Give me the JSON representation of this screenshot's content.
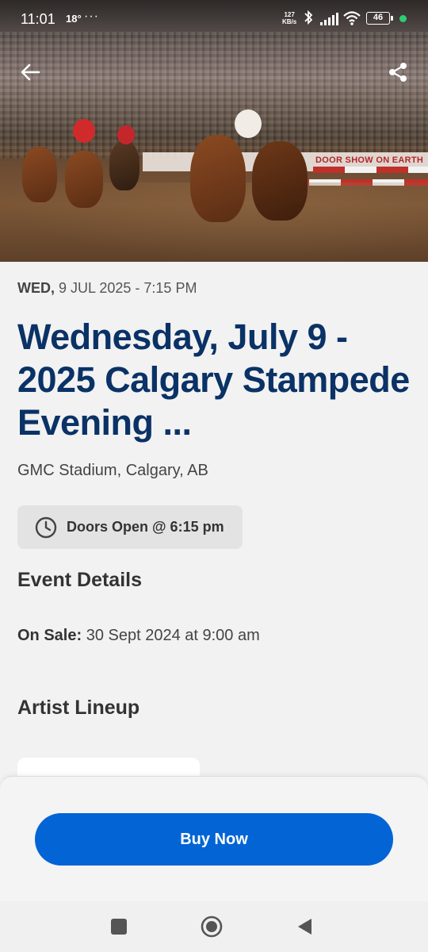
{
  "status_bar": {
    "time": "11:01",
    "temperature": "18°",
    "more": "···",
    "net_speed_value": "127",
    "net_speed_unit": "KB/s",
    "battery": "46"
  },
  "hero": {
    "banner_text": "DOOR SHOW ON EARTH",
    "back_icon": "arrow-left-icon",
    "share_icon": "share-icon"
  },
  "event": {
    "day": "WED,",
    "date_time": "9 JUL 2025 - 7:15 PM",
    "title": "Wednesday, July 9 - 2025 Calgary Stampede Evening ...",
    "venue": "GMC Stadium, Calgary, AB",
    "doors": "Doors Open @ 6:15 pm"
  },
  "details": {
    "heading": "Event Details",
    "on_sale_label": "On Sale:",
    "on_sale_value": "30 Sept 2024 at 9:00 am"
  },
  "lineup": {
    "heading": "Artist Lineup"
  },
  "cta": {
    "buy_label": "Buy Now",
    "color": "#0364d6"
  },
  "colors": {
    "title": "#0a3266",
    "background": "#f2f2f2"
  }
}
